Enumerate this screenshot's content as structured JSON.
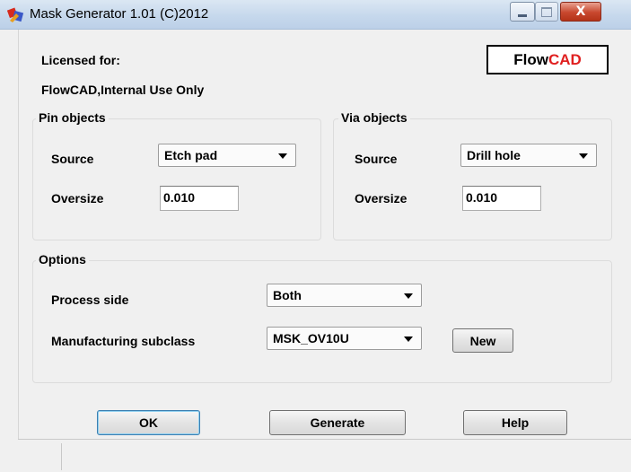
{
  "window": {
    "title": "Mask Generator 1.01 (C)2012",
    "caption_buttons": {
      "minimize_icon": "minimize-icon",
      "maximize_icon": "maximize-icon",
      "close_glyph": "X"
    }
  },
  "license": {
    "label": "Licensed for:",
    "holder": "FlowCAD,Internal Use Only"
  },
  "logo": {
    "part1": "Flow",
    "part2": "CAD",
    "color_part1": "#000000",
    "color_part2": "#e02020"
  },
  "pin_objects": {
    "title": "Pin objects",
    "source_label": "Source",
    "source_value": "Etch pad",
    "oversize_label": "Oversize",
    "oversize_value": "0.010"
  },
  "via_objects": {
    "title": "Via objects",
    "source_label": "Source",
    "source_value": "Drill hole",
    "oversize_label": "Oversize",
    "oversize_value": "0.010"
  },
  "options": {
    "title": "Options",
    "process_side_label": "Process side",
    "process_side_value": "Both",
    "subclass_label": "Manufacturing subclass",
    "subclass_value": "MSK_OV10U",
    "new_button": "New"
  },
  "buttons": {
    "ok": "OK",
    "generate": "Generate",
    "help": "Help"
  },
  "colors": {
    "dialog_bg": "#f0f0f0",
    "titlebar": "#c6d8ec",
    "close_button": "#c8472e",
    "default_button_border": "#3c7fb1"
  }
}
